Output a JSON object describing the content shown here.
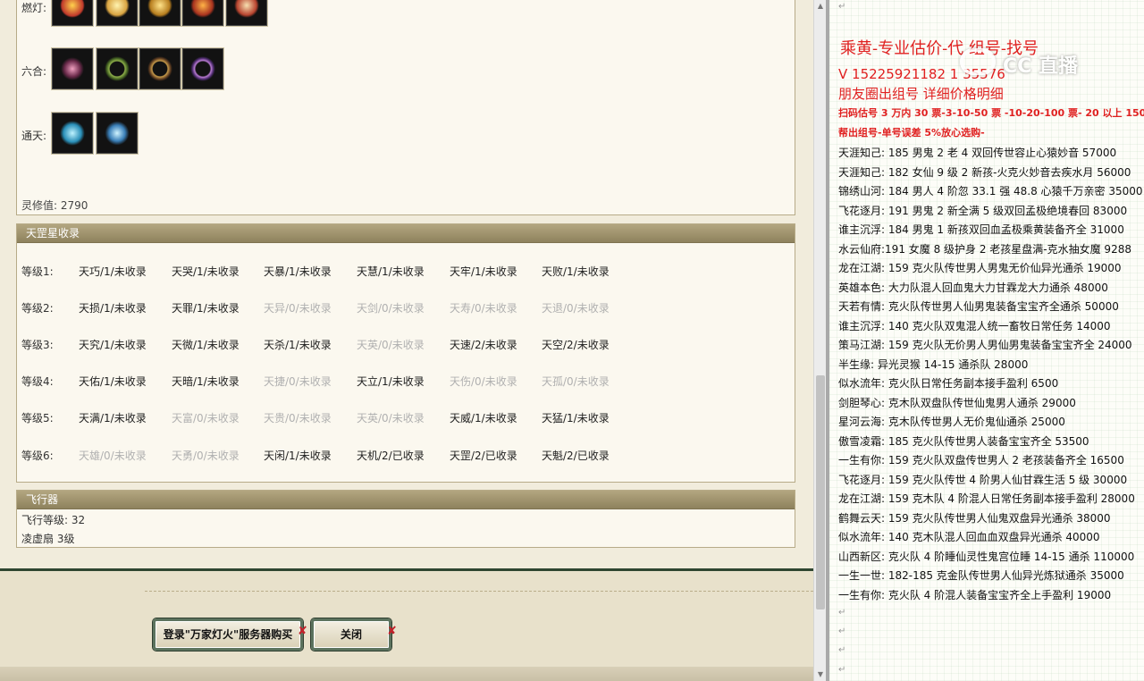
{
  "left_panel": {
    "items": [
      {
        "label": "燃灯:",
        "icons": [
          "lantern-red-icon",
          "bell-gold-icon",
          "statue-gold-icon",
          "flame-orange-icon",
          "bell-red-icon"
        ]
      },
      {
        "label": "六合:",
        "icons": [
          "pendant-icon",
          "ring-green-icon",
          "ring-purple-icon",
          "bracelet-purple-icon"
        ]
      },
      {
        "label": "通天:",
        "icons": [
          "orb-blue-icon",
          "key-blue-icon"
        ]
      }
    ],
    "lingxiu_value": "灵修值: 2790"
  },
  "star_panel": {
    "title": "天罡星收录",
    "rows": [
      {
        "label": "等级1:",
        "cells": [
          {
            "text": "天巧/1/未收录",
            "dim": false
          },
          {
            "text": "天哭/1/未收录",
            "dim": false
          },
          {
            "text": "天暴/1/未收录",
            "dim": false
          },
          {
            "text": "天慧/1/未收录",
            "dim": false
          },
          {
            "text": "天牢/1/未收录",
            "dim": false
          },
          {
            "text": "天败/1/未收录",
            "dim": false
          }
        ]
      },
      {
        "label": "等级2:",
        "cells": [
          {
            "text": "天损/1/未收录",
            "dim": false
          },
          {
            "text": "天罪/1/未收录",
            "dim": false
          },
          {
            "text": "天异/0/未收录",
            "dim": true
          },
          {
            "text": "天剑/0/未收录",
            "dim": true
          },
          {
            "text": "天寿/0/未收录",
            "dim": true
          },
          {
            "text": "天退/0/未收录",
            "dim": true
          }
        ]
      },
      {
        "label": "等级3:",
        "cells": [
          {
            "text": "天究/1/未收录",
            "dim": false
          },
          {
            "text": "天微/1/未收录",
            "dim": false
          },
          {
            "text": "天杀/1/未收录",
            "dim": false
          },
          {
            "text": "天英/0/未收录",
            "dim": true
          },
          {
            "text": "天速/2/未收录",
            "dim": false
          },
          {
            "text": "天空/2/未收录",
            "dim": false
          }
        ]
      },
      {
        "label": "等级4:",
        "cells": [
          {
            "text": "天佑/1/未收录",
            "dim": false
          },
          {
            "text": "天暗/1/未收录",
            "dim": false
          },
          {
            "text": "天捷/0/未收录",
            "dim": true
          },
          {
            "text": "天立/1/未收录",
            "dim": false
          },
          {
            "text": "天伤/0/未收录",
            "dim": true
          },
          {
            "text": "天孤/0/未收录",
            "dim": true
          }
        ]
      },
      {
        "label": "等级5:",
        "cells": [
          {
            "text": "天满/1/未收录",
            "dim": false
          },
          {
            "text": "天富/0/未收录",
            "dim": true
          },
          {
            "text": "天贵/0/未收录",
            "dim": true
          },
          {
            "text": "天英/0/未收录",
            "dim": true
          },
          {
            "text": "天威/1/未收录",
            "dim": false
          },
          {
            "text": "天猛/1/未收录",
            "dim": false
          }
        ]
      },
      {
        "label": "等级6:",
        "cells": [
          {
            "text": "天雄/0/未收录",
            "dim": true
          },
          {
            "text": "天勇/0/未收录",
            "dim": true
          },
          {
            "text": "天闲/1/未收录",
            "dim": false
          },
          {
            "text": "天机/2/已收录",
            "dim": false
          },
          {
            "text": "天罡/2/已收录",
            "dim": false
          },
          {
            "text": "天魁/2/已收录",
            "dim": false
          }
        ]
      }
    ]
  },
  "flyer_panel": {
    "title": "飞行器",
    "lines": [
      "飞行等级: 32",
      "凌虚扇  3级"
    ]
  },
  "buttons": {
    "login_label": "登录\"万家灯火\"服务器购买",
    "close_label": "关闭",
    "x_mark": "✘"
  },
  "right_panel": {
    "heading": "乘黄-专业估价-代 组号-找号",
    "contact": " V 15225921182   1  35576",
    "subheading": "朋友圈出组号   详细价格明细",
    "notice1": "扫码估号 3 万内 30 票-3-10-50 票  -10-20-100 票- 20 以上 150",
    "notice2": "帮出组号-单号误差 5%放心选购-",
    "watermark": "CC 直播",
    "paragraph_mark": "↵",
    "lines": [
      "天涯知己: 185 男鬼 2 老 4 双回传世容止心猿妙音 57000",
      "天涯知己: 182 女仙 9 级 2 新孩-火克火妙音去疾水月 56000",
      "锦绣山河: 184 男人 4 阶忽 33.1 强 48.8 心猿千万亲密 35000",
      "飞花逐月: 191 男鬼 2 新全满 5 级双回孟极绝境春回 83000",
      "谁主沉浮: 184 男鬼 1 新孩双回血孟极乘黄装备齐全 31000",
      "水云仙府:191 女魔 8 级护身 2 老孩星盘满-克水抽女魔 9288",
      "龙在江湖: 159 克火队传世男人男鬼无价仙异光通杀 19000",
      "英雄本色: 大力队混人回血鬼大力甘霖龙大力通杀 48000",
      "天若有情: 克火队传世男人仙男鬼装备宝宝齐全通杀 50000",
      "谁主沉浮: 140 克火队双鬼混人统一畜牧日常任务 14000",
      "策马江湖: 159 克火队无价男人男仙男鬼装备宝宝齐全 24000",
      "半生缘: 异光灵猴 14-15 通杀队 28000",
      "似水流年: 克火队日常任务副本接手盈利 6500",
      "剑胆琴心: 克木队双盘队传世仙鬼男人通杀 29000",
      "星河云海: 克木队传世男人无价鬼仙通杀 25000",
      "傲雪凌霜: 185 克火队传世男人装备宝宝齐全 53500",
      "一生有你: 159 克火队双盘传世男人 2 老孩装备齐全 16500",
      "飞花逐月: 159 克火队传世 4 阶男人仙甘霖生活 5 级 30000",
      "龙在江湖: 159 克木队 4 阶混人日常任务副本接手盈利 28000",
      "鹤舞云天: 159 克火队传世男人仙鬼双盘异光通杀 38000",
      "似水流年: 140 克木队混人回血血双盘异光通杀 40000",
      "山西新区: 克火队 4 阶睡仙灵性鬼宫位睡 14-15 通杀 110000",
      "一生一世: 182-185 克金队传世男人仙异光炼狱通杀 35000",
      "一生有你: 克火队 4 阶混人装备宝宝齐全上手盈利 19000"
    ]
  }
}
